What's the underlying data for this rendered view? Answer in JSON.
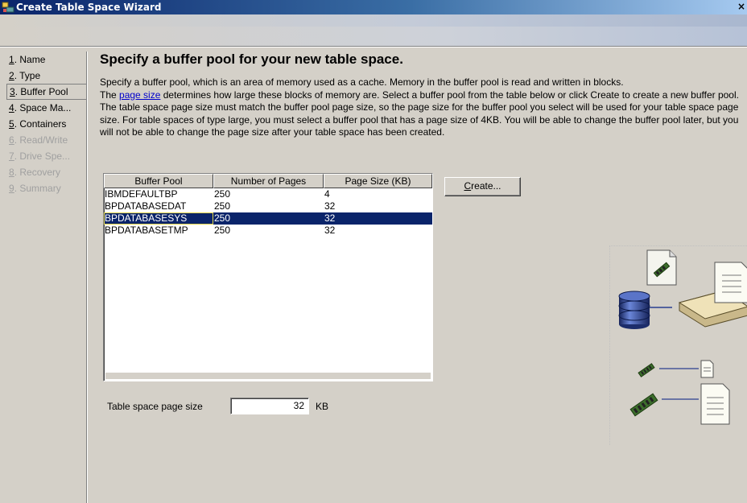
{
  "window": {
    "title": "Create Table Space Wizard",
    "close_glyph": "×"
  },
  "nav": {
    "items": [
      {
        "mnemonic": "1",
        "rest": ". Name",
        "state": "enabled"
      },
      {
        "mnemonic": "2",
        "rest": ". Type",
        "state": "enabled"
      },
      {
        "mnemonic": "3",
        "rest": ". Buffer Pool",
        "state": "current"
      },
      {
        "mnemonic": "4",
        "rest": ". Space Ma...",
        "state": "enabled"
      },
      {
        "mnemonic": "5",
        "rest": ". Containers",
        "state": "enabled"
      },
      {
        "mnemonic": "6",
        "rest": ". Read/Write",
        "state": "disabled"
      },
      {
        "mnemonic": "7",
        "rest": ". Drive Spe...",
        "state": "disabled"
      },
      {
        "mnemonic": "8",
        "rest": ". Recovery",
        "state": "disabled"
      },
      {
        "mnemonic": "9",
        "rest": ". Summary",
        "state": "disabled"
      }
    ]
  },
  "main": {
    "title": "Specify a buffer pool for your new table space.",
    "desc_line1": "Specify a buffer pool, which is an area of memory used as a cache.  Memory in the buffer pool is read and written in blocks.",
    "desc_pre_link": "The ",
    "desc_link": "page size",
    "desc_post_link": " determines how large these blocks of memory are.  Select a buffer pool from the table below or click Create to create a new buffer pool.  The table space page size must match the buffer pool page size, so the page size for the buffer pool you select will be used for your table space page size.  For table spaces of type large, you must select a buffer pool that has a page size of 4KB.  You will be able to change the buffer pool later, but you will not be able to change the page size after your table space has been created."
  },
  "table": {
    "columns": [
      "Buffer Pool",
      "Number of Pages",
      "Page Size (KB)"
    ],
    "rows": [
      {
        "name": "IBMDEFAULTBP",
        "pages": "250",
        "size": "4",
        "selected": false
      },
      {
        "name": "BPDATABASEDAT",
        "pages": "250",
        "size": "32",
        "selected": false
      },
      {
        "name": "BPDATABASESYS",
        "pages": "250",
        "size": "32",
        "selected": true
      },
      {
        "name": "BPDATABASETMP",
        "pages": "250",
        "size": "32",
        "selected": false
      }
    ]
  },
  "create_button": {
    "mnemonic": "C",
    "rest": "reate..."
  },
  "page_size": {
    "label": "Table space page size",
    "value": "32",
    "unit": "KB"
  },
  "colors": {
    "selection": "#0a246a",
    "link": "#0000cc",
    "disabled_text": "#a0a0a0"
  }
}
